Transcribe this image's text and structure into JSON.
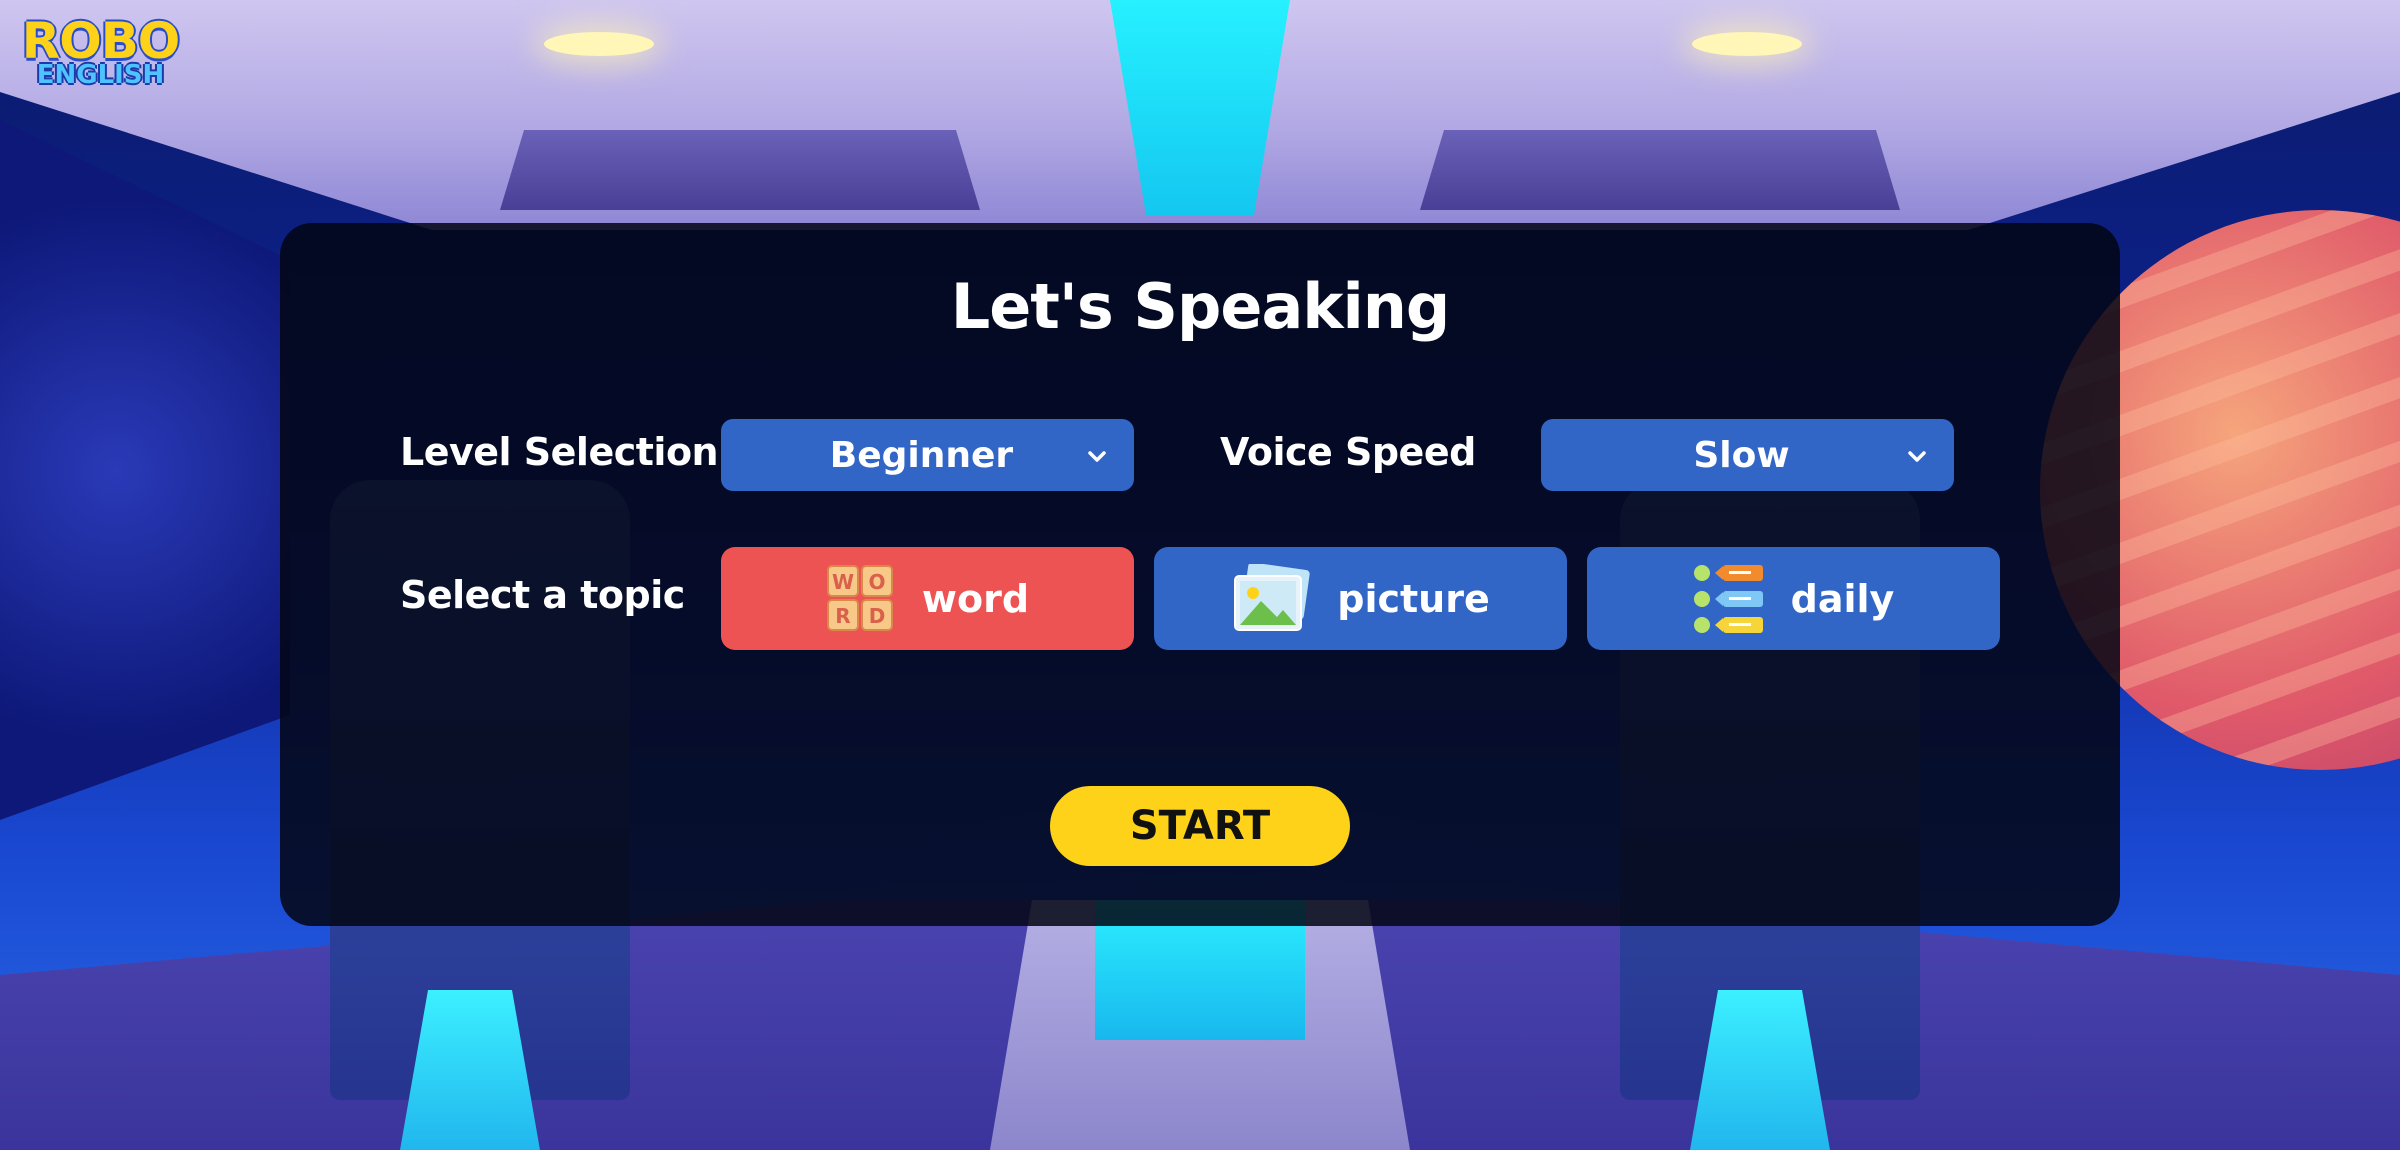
{
  "logo": {
    "line1": "ROBO",
    "line2": "ENGLISH"
  },
  "page": {
    "title": "Let's Speaking"
  },
  "level": {
    "label": "Level Selection",
    "value": "Beginner",
    "icon": "chevron-down-icon"
  },
  "speed": {
    "label": "Voice Speed",
    "value": "Slow",
    "icon": "chevron-down-icon"
  },
  "topics": {
    "label": "Select a topic",
    "selected": "word",
    "items": [
      {
        "label": "word",
        "icon": "word-tiles-icon",
        "icon_letters": [
          "W",
          "O",
          "R",
          "D"
        ],
        "state": "selected"
      },
      {
        "label": "picture",
        "icon": "picture-icon",
        "state": "default"
      },
      {
        "label": "daily",
        "icon": "list-icon",
        "state": "default"
      }
    ]
  },
  "start": {
    "label": "START"
  },
  "colors": {
    "accent_blue": "#3166c7",
    "selected_red": "#ee5354",
    "start_yellow": "#ffd21a",
    "card_bg": "rgba(3,6,20,0.86)"
  }
}
